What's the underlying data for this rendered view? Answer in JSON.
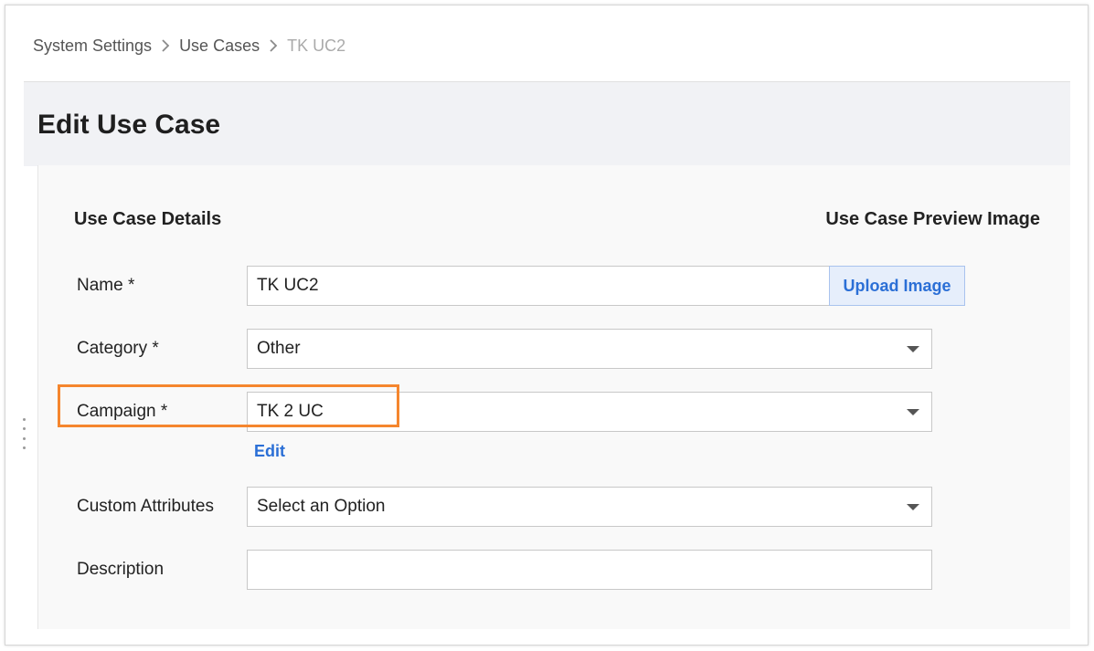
{
  "breadcrumb": {
    "items": [
      "System Settings",
      "Use Cases",
      "TK UC2"
    ]
  },
  "page": {
    "title": "Edit Use Case"
  },
  "sections": {
    "details_title": "Use Case Details",
    "preview_title": "Use Case Preview Image"
  },
  "form": {
    "name_label": "Name *",
    "name_value": "TK UC2",
    "upload_label": "Upload Image",
    "category_label": "Category *",
    "category_value": "Other",
    "campaign_label": "Campaign *",
    "campaign_value": "TK 2 UC",
    "edit_link": "Edit",
    "custom_attributes_label": "Custom Attributes",
    "custom_attributes_value": "Select an Option",
    "description_label": "Description",
    "description_value": ""
  },
  "colors": {
    "accent": "#2b6fd6",
    "highlight": "#f5862e",
    "header_band": "#f1f2f5"
  },
  "icons": {
    "breadcrumb_separator": "chevron-right-icon",
    "dropdown": "caret-down-icon",
    "resize_handle": "drag-handle-icon"
  }
}
